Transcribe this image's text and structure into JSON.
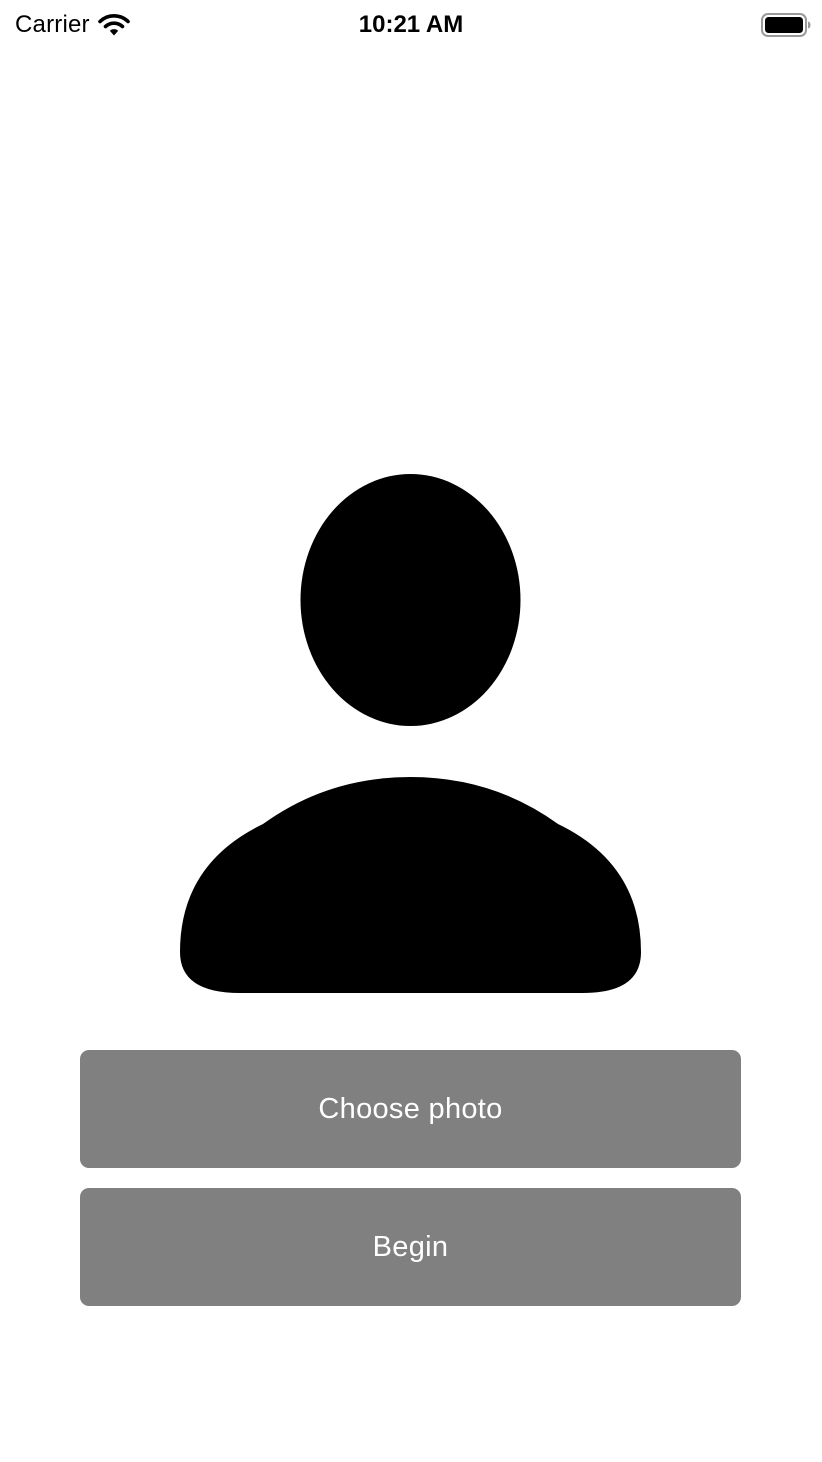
{
  "status_bar": {
    "carrier": "Carrier",
    "time": "10:21 AM",
    "wifi_icon": "wifi-icon",
    "battery_icon": "battery-full-icon"
  },
  "avatar": {
    "icon": "person-silhouette-icon",
    "color": "#000000"
  },
  "buttons": {
    "choose_photo_label": "Choose photo",
    "begin_label": "Begin",
    "background_color": "#808080",
    "text_color": "#ffffff"
  }
}
